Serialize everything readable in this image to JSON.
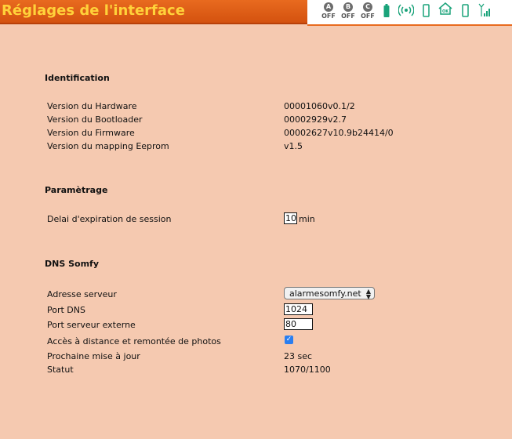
{
  "page_title": "Réglages de l'interface",
  "status": {
    "zones": [
      {
        "letter": "A",
        "state": "OFF"
      },
      {
        "letter": "B",
        "state": "OFF"
      },
      {
        "letter": "C",
        "state": "OFF"
      }
    ],
    "icons": [
      "battery-icon",
      "wireless-signal-icon",
      "phone-icon",
      "home-ok-icon",
      "phone-outline-icon",
      "gsm-signal-icon"
    ],
    "accent_color": "#1aa37a"
  },
  "identification": {
    "title": "Identification",
    "rows": [
      {
        "label": "Version du Hardware",
        "value": "00001060v0.1/2"
      },
      {
        "label": "Version du Bootloader",
        "value": "00002929v2.7"
      },
      {
        "label": "Version du Firmware",
        "value": "00002627v10.9b24414/0"
      },
      {
        "label": "Version du mapping Eeprom",
        "value": "v1.5"
      }
    ]
  },
  "parametrage": {
    "title": "Paramètrage",
    "session_label": "Delai d'expiration de session",
    "session_value": "10",
    "session_unit": "min"
  },
  "dns": {
    "title": "DNS Somfy",
    "server_label": "Adresse serveur",
    "server_value": "alarmesomfy.net",
    "port_dns_label": "Port DNS",
    "port_dns_value": "1024",
    "port_ext_label": "Port serveur externe",
    "port_ext_value": "80",
    "remote_label": "Accès à distance et remontée de photos",
    "remote_checked": true,
    "next_update_label": "Prochaine mise à jour",
    "next_update_value": "23 sec",
    "status_label": "Statut",
    "status_value": "1070/1100"
  }
}
